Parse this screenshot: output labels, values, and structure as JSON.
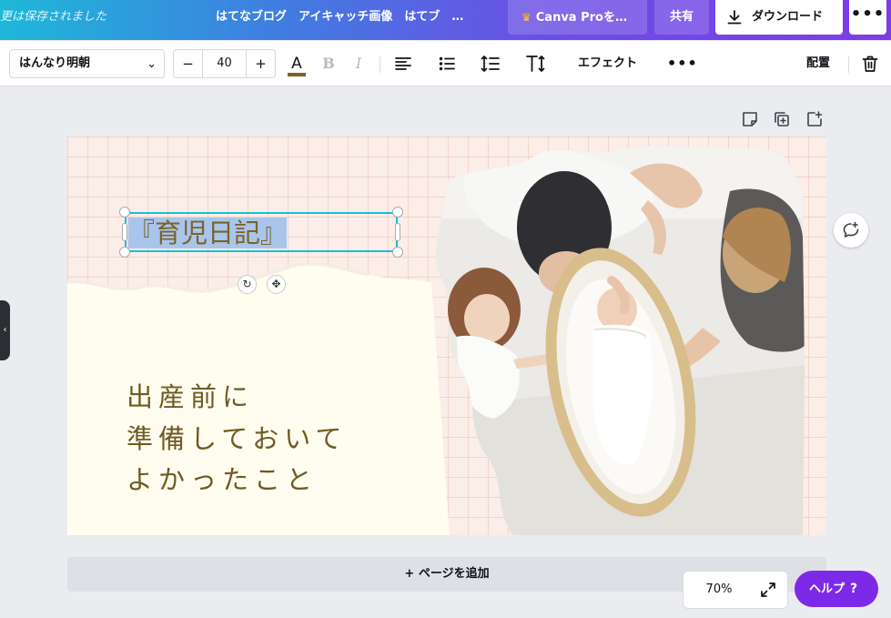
{
  "header": {
    "saved_status": "更は保存されました",
    "project_title": "はてなブログ　アイキャッチ画像　はてブ　…",
    "pro_button": "Canva Proを…",
    "share_button": "共有",
    "download_button": "ダウンロード",
    "more_button": "•••"
  },
  "toolbar": {
    "font_name": "はんなり明朝",
    "font_chevron": "⌄",
    "font_size": "40",
    "size_minus": "−",
    "size_plus": "+",
    "text_color_glyph": "A",
    "text_color": "#7a6326",
    "bold_glyph": "B",
    "italic_glyph": "I",
    "effect_label": "エフェクト",
    "more_label": "•••",
    "position_label": "配置"
  },
  "canvas": {
    "title_text": "『育児日記』",
    "body_lines": [
      "出産前に",
      "準備しておいて",
      "よかったこと"
    ],
    "text_color": "#6f5a23",
    "accent_selection": "#15c0d6",
    "background_color": "#fbede8"
  },
  "bottom": {
    "add_page": "+ ページを追加",
    "zoom": "70%",
    "help": "ヘルプ",
    "help_glyph": "?"
  },
  "icons": [
    "download-icon",
    "align-left-icon",
    "bullet-list-icon",
    "line-spacing-icon",
    "text-size-icon",
    "trash-icon",
    "note-icon",
    "duplicate-icon",
    "add-page-icon",
    "comment-add-icon",
    "rotate-icon",
    "move-icon",
    "fullscreen-icon",
    "crown-icon",
    "chevron-left-icon"
  ],
  "colors": {
    "brand_purple": "#7d2ae8",
    "brand_teal": "#1eb8d8"
  }
}
